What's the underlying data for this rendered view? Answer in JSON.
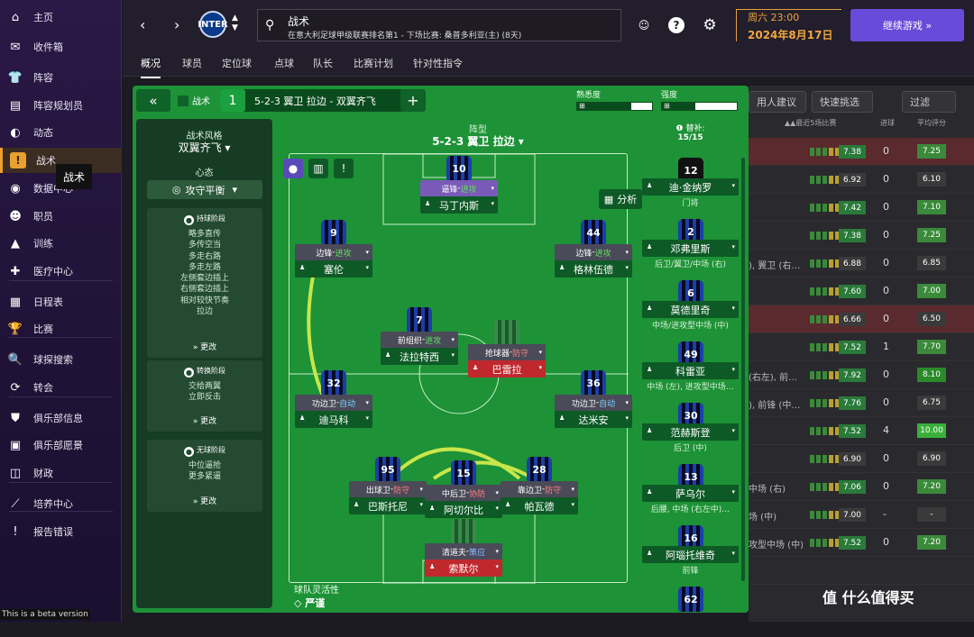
{
  "sidebar": {
    "items": [
      {
        "label": "主页",
        "icon": "home-icon",
        "glyph": "⌂"
      },
      {
        "label": "收件箱",
        "icon": "inbox-icon",
        "glyph": "✉"
      },
      {
        "label": "阵容",
        "icon": "shirt-icon",
        "glyph": "👕"
      },
      {
        "label": "阵容规划员",
        "icon": "clipboard-icon",
        "glyph": "▤"
      },
      {
        "label": "动态",
        "icon": "chat-icon",
        "glyph": "◐"
      },
      {
        "label": "战术",
        "icon": "tactics-icon",
        "glyph": "!"
      },
      {
        "label": "数据中心",
        "icon": "data-icon",
        "glyph": "◉"
      },
      {
        "label": "职员",
        "icon": "staff-icon",
        "glyph": "☻"
      },
      {
        "label": "训练",
        "icon": "training-icon",
        "glyph": "▲"
      },
      {
        "label": "医疗中心",
        "icon": "medical-icon",
        "glyph": "✚"
      },
      {
        "label": "日程表",
        "icon": "calendar-icon",
        "glyph": "▦"
      },
      {
        "label": "比赛",
        "icon": "trophy-icon",
        "glyph": "🏆"
      },
      {
        "label": "球探搜索",
        "icon": "scout-icon",
        "glyph": "🔍"
      },
      {
        "label": "转会",
        "icon": "transfer-icon",
        "glyph": "⟳"
      },
      {
        "label": "俱乐部信息",
        "icon": "shield-icon",
        "glyph": "⛊"
      },
      {
        "label": "俱乐部愿景",
        "icon": "briefcase-icon",
        "glyph": "▣"
      },
      {
        "label": "财政",
        "icon": "finance-icon",
        "glyph": "◫"
      },
      {
        "label": "培养中心",
        "icon": "development-icon",
        "glyph": "⟋"
      },
      {
        "label": "报告错误",
        "icon": "bug-icon",
        "glyph": "!"
      }
    ],
    "tooltip": "战术",
    "beta": "This is a beta version"
  },
  "topbar": {
    "search_title": "战术",
    "search_sub": "在意大利足球甲级联赛排名第1 - 下场比赛: 桑普多利亚(主) (8天)",
    "logo": "INTER",
    "date_line1": "周六 23:00",
    "date_line2": "2024年8月17日",
    "continue": "继续游戏 »",
    "help": "?"
  },
  "tabs": [
    "概况",
    "球员",
    "定位球",
    "点球",
    "队长",
    "比赛计划",
    "针对性指令"
  ],
  "bg_table": {
    "header_btns": [
      "用人建议",
      "快速挑选",
      "过滤"
    ],
    "cols": [
      "▲▲最近5场比赛",
      "进球",
      "平均评分"
    ],
    "rows": [
      {
        "txt": "",
        "rating": "7.38",
        "goals": "0",
        "avg": "7.25",
        "hl": true,
        "rc": "#2a7a3a",
        "ac": "#3a8a3a"
      },
      {
        "txt": "",
        "rating": "6.92",
        "goals": "0",
        "avg": "6.10",
        "rc": "#3a3a3a",
        "ac": "#3a3a3a"
      },
      {
        "txt": "",
        "rating": "7.42",
        "goals": "0",
        "avg": "7.10",
        "rc": "#2a7a3a",
        "ac": "#3a8a3a"
      },
      {
        "txt": "",
        "rating": "7.38",
        "goals": "0",
        "avg": "7.25",
        "rc": "#2a7a3a",
        "ac": "#3a8a3a"
      },
      {
        "txt": "), 翼卫 (右…",
        "rating": "6.88",
        "goals": "0",
        "avg": "6.85",
        "rc": "#3a3a3a",
        "ac": "#3a3a3a"
      },
      {
        "txt": "",
        "rating": "7.60",
        "goals": "0",
        "avg": "7.00",
        "rc": "#2a7a3a",
        "ac": "#3a8a3a"
      },
      {
        "txt": "",
        "rating": "6.66",
        "goals": "0",
        "avg": "6.50",
        "hl": true,
        "rc": "#3a3a3a",
        "ac": "#3a3a3a"
      },
      {
        "txt": "",
        "rating": "7.52",
        "goals": "1",
        "avg": "7.70",
        "rc": "#2a7a3a",
        "ac": "#3a8a3a"
      },
      {
        "txt": "(右左), 前…",
        "rating": "7.92",
        "goals": "0",
        "avg": "8.10",
        "rc": "#2a7a3a",
        "ac": "#2a8a2a"
      },
      {
        "txt": "), 前锋 (中…",
        "rating": "7.76",
        "goals": "0",
        "avg": "6.75",
        "rc": "#2a7a3a",
        "ac": "#3a3a3a"
      },
      {
        "txt": "",
        "rating": "7.52",
        "goals": "4",
        "avg": "10.00",
        "rc": "#2a7a3a",
        "ac": "#3ab03a"
      },
      {
        "txt": "",
        "rating": "6.90",
        "goals": "0",
        "avg": "6.90",
        "rc": "#3a3a3a",
        "ac": "#3a3a3a"
      },
      {
        "txt": "中场 (右)",
        "rating": "7.06",
        "goals": "0",
        "avg": "7.20",
        "rc": "#2a7a3a",
        "ac": "#3a8a3a"
      },
      {
        "txt": "场 (中)",
        "rating": "7.00",
        "goals": "-",
        "avg": "-",
        "rc": "#3a3a3a",
        "ac": "#3a3a3a"
      },
      {
        "txt": "攻型中场 (中)",
        "rating": "7.52",
        "goals": "0",
        "avg": "7.20",
        "rc": "#2a7a3a",
        "ac": "#3a8a3a"
      },
      {
        "txt": "",
        "rating": "",
        "goals": "",
        "avg": "",
        "rc": "#2a2a2e",
        "ac": "#2a2a2e"
      }
    ]
  },
  "tactic": {
    "label": "战术",
    "slot_num": "1",
    "slot_name": "5-2-3 翼卫 拉边 - 双翼齐飞",
    "familiarity_label": "熟悉度",
    "familiarity": 0.72,
    "intensity_label": "强度",
    "intensity": 0.45,
    "style_label": "战术风格",
    "style_value": "双翼齐飞",
    "mentality_label": "心态",
    "mentality_value": "攻守平衡",
    "formation_label": "阵型",
    "formation_value": "5-2-3 翼卫 拉边",
    "analysis": "分析",
    "flex_label": "球队灵活性",
    "flex_value": "严谨"
  },
  "phases": [
    {
      "title": "持球阶段",
      "instructions": [
        "略多直传",
        "多传空当",
        "多走右路",
        "多走左路",
        "左侧套边插上",
        "右侧套边插上",
        "相对较快节奏",
        "拉边"
      ],
      "change": "» 更改"
    },
    {
      "title": "转换阶段",
      "instructions": [
        "交给两翼",
        "立即反击"
      ],
      "change": "» 更改"
    },
    {
      "title": "无球阶段",
      "instructions": [
        "中位逼抢",
        "更多紧逼"
      ],
      "change": "» 更改"
    }
  ],
  "players": [
    {
      "num": "10",
      "role": "逼锋",
      "duty": "进攻",
      "duty_class": "attack",
      "name": "马丁内斯",
      "red": false
    },
    {
      "num": "9",
      "role": "边锋",
      "duty": "进攻",
      "duty_class": "attack",
      "name": "塞伦",
      "red": false
    },
    {
      "num": "44",
      "role": "边锋",
      "duty": "进攻",
      "duty_class": "attack",
      "name": "格林伍德",
      "red": false
    },
    {
      "num": "7",
      "role": "前组织",
      "duty": "进攻",
      "duty_class": "attack",
      "name": "法拉特西",
      "red": false
    },
    {
      "num": "",
      "role": "抢球器",
      "duty": "防守",
      "duty_class": "defend",
      "name": "巴雷拉",
      "red": true
    },
    {
      "num": "32",
      "role": "功边卫",
      "duty": "自动",
      "duty_class": "auto",
      "name": "迪马科",
      "red": false
    },
    {
      "num": "36",
      "role": "功边卫",
      "duty": "自动",
      "duty_class": "auto",
      "name": "达米安",
      "red": false
    },
    {
      "num": "95",
      "role": "出球卫",
      "duty": "防守",
      "duty_class": "defend",
      "name": "巴斯托尼",
      "red": false
    },
    {
      "num": "15",
      "role": "中后卫",
      "duty": "协防",
      "duty_class": "defend",
      "name": "阿切尔比",
      "red": false
    },
    {
      "num": "28",
      "role": "靠边卫",
      "duty": "防守",
      "duty_class": "defend",
      "name": "帕瓦德",
      "red": false
    },
    {
      "num": "",
      "role": "清道夫",
      "duty": "策应",
      "duty_class": "support",
      "name": "索默尔",
      "red": true
    }
  ],
  "subs_label": "替补:",
  "subs_count": "15/15",
  "subs": [
    {
      "num": "12",
      "name": "迪·金纳罗",
      "pos": "门将",
      "gk": true
    },
    {
      "num": "2",
      "name": "邓弗里斯",
      "pos": "后卫/翼卫/中场 (右)"
    },
    {
      "num": "6",
      "name": "莫德里奇",
      "pos": "中场/进攻型中场 (中)"
    },
    {
      "num": "49",
      "name": "科雷亚",
      "pos": "中场 (左), 进攻型中场…"
    },
    {
      "num": "30",
      "name": "范赫斯登",
      "pos": "后卫 (中)"
    },
    {
      "num": "13",
      "name": "萨乌尔",
      "pos": "后腰, 中场 (右左中)…"
    },
    {
      "num": "16",
      "name": "阿瑙托维奇",
      "pos": "前锋"
    },
    {
      "num": "62",
      "name": "",
      "pos": ""
    }
  ],
  "watermark": "值 什么值得买"
}
